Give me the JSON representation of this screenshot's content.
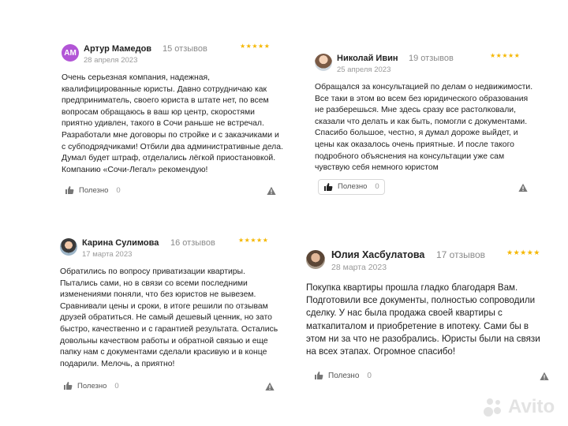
{
  "reviews": [
    {
      "author": "Артур Мамедов",
      "avatar_text": "AM",
      "reviews_count": "15 отзывов",
      "date": "28 апреля 2023",
      "rating": 5,
      "stars": "★★★★★",
      "text": "Очень серьезная компания, надежная, квалифицированные юристы. Давно сотрудничаю как предприниматель, своего юриста в штате нет, по всем вопросам обращаюсь в ваш юр центр, скоростями приятно удивлен, такого в Сочи раньше не встречал. Разработали мне договоры по стройке и с заказчиками и с субподрядчиками! Отбили два административные дела. Думал будет штраф, отделались лёгкой приостановкой. Компанию «Сочи-Легал» рекомендую!",
      "helpful_label": "Полезно",
      "helpful_count": "0"
    },
    {
      "author": "Николай Ивин",
      "reviews_count": "19 отзывов",
      "date": "25 апреля 2023",
      "rating": 5,
      "stars": "★★★★★",
      "text": "Обращался за консультацией по делам о недвижимости. Все таки в этом во всем без юридического образования не разберешься. Мне здесь сразу все растолковали, сказали что делать и как быть, помогли с документами. Спасибо большое, честно, я думал дороже выйдет, и цены как оказалось очень приятные. И после такого подробного объяснения на консультации уже сам чувствую себя немного юристом",
      "helpful_label": "Полезно",
      "helpful_count": "0"
    },
    {
      "author": "Карина Сулимова",
      "reviews_count": "16 отзывов",
      "date": "17 марта 2023",
      "rating": 5,
      "stars": "★★★★★",
      "text": "Обратились по вопросу приватизации квартиры. Пытались сами, но в связи со всеми последними изменениями поняли, что без юристов не вывезем. Сравнивали цены и сроки, в итоге решили по отзывам друзей обратиться. Не самый дешевый ценник, но зато быстро, качественно и с гарантией результата. Остались довольны качеством работы и обратной связью и еще папку нам с документами сделали красивую и в конце подарили. Мелочь, а приятно!",
      "helpful_label": "Полезно",
      "helpful_count": "0"
    },
    {
      "author": "Юлия Хасбулатова",
      "reviews_count": "17 отзывов",
      "date": "28 марта 2023",
      "rating": 5,
      "stars": "★★★★★",
      "text": "Покупка квартиры прошла гладко благодаря Вам. Подготовили все документы, полностью сопроводили сделку. У нас была продажа своей квартиры с маткапиталом и приобретение в ипотеку. Сами бы в этом ни за что не разобрались. Юристы были на связи на всех этапах. Огромное спасибо!",
      "helpful_label": "Полезно",
      "helpful_count": "0"
    }
  ],
  "watermark": "Avito",
  "colors": {
    "star": "#f5b700",
    "avatar_initials_bg": "#b255d6",
    "muted": "#8a8a8a"
  }
}
